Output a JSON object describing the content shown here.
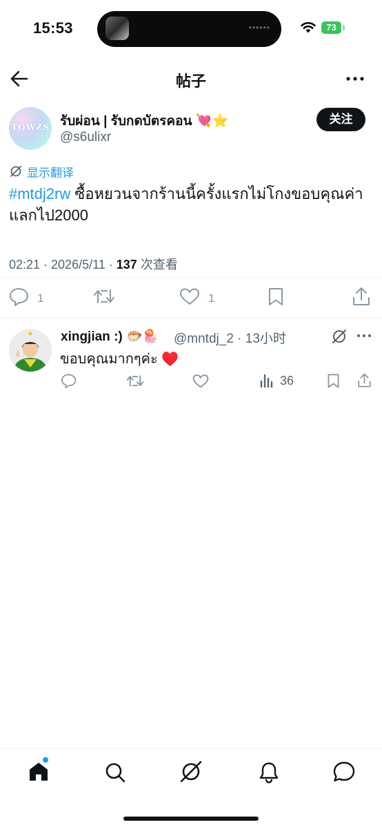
{
  "status_bar": {
    "time": "15:53",
    "battery": "73",
    "island_dots": "••••••"
  },
  "header": {
    "title": "帖子"
  },
  "post": {
    "display_name": "รับผ่อน | รับกดบัตรคอน",
    "name_emojis": "💘⭐",
    "handle": "@s6ulixr",
    "avatar_text": "TQWZS",
    "follow_label": "关注",
    "translate_label": "显示翻译",
    "hashtag": "#mtdj2rw",
    "text": " ซื้อหยวนจากร้านนี้ครั้งแรกไม่โกงขอบคุณค่าแลกไป2000",
    "timestamp": "02:21 · 2026/5/11 · ",
    "views_count": "137",
    "views_label": " 次查看",
    "reply_count": "1",
    "like_count": "1"
  },
  "reply": {
    "name": "xingjian :)",
    "name_emojis": "🐡🪼",
    "handle": "@mntdj_2",
    "time": " · 13小时",
    "text": "ขอบคุณมากๆค่ะ",
    "text_emoji": "♥️",
    "views": "36"
  },
  "nav": {
    "items": [
      "home-icon",
      "search-icon",
      "grok-icon",
      "notifications-icon",
      "messages-icon"
    ],
    "active": "home-icon"
  },
  "colors": {
    "accent": "#1d9bf0",
    "text": "#0f1419",
    "secondary": "#536471",
    "battery": "#34c759",
    "like_heart": "#e0245e"
  }
}
